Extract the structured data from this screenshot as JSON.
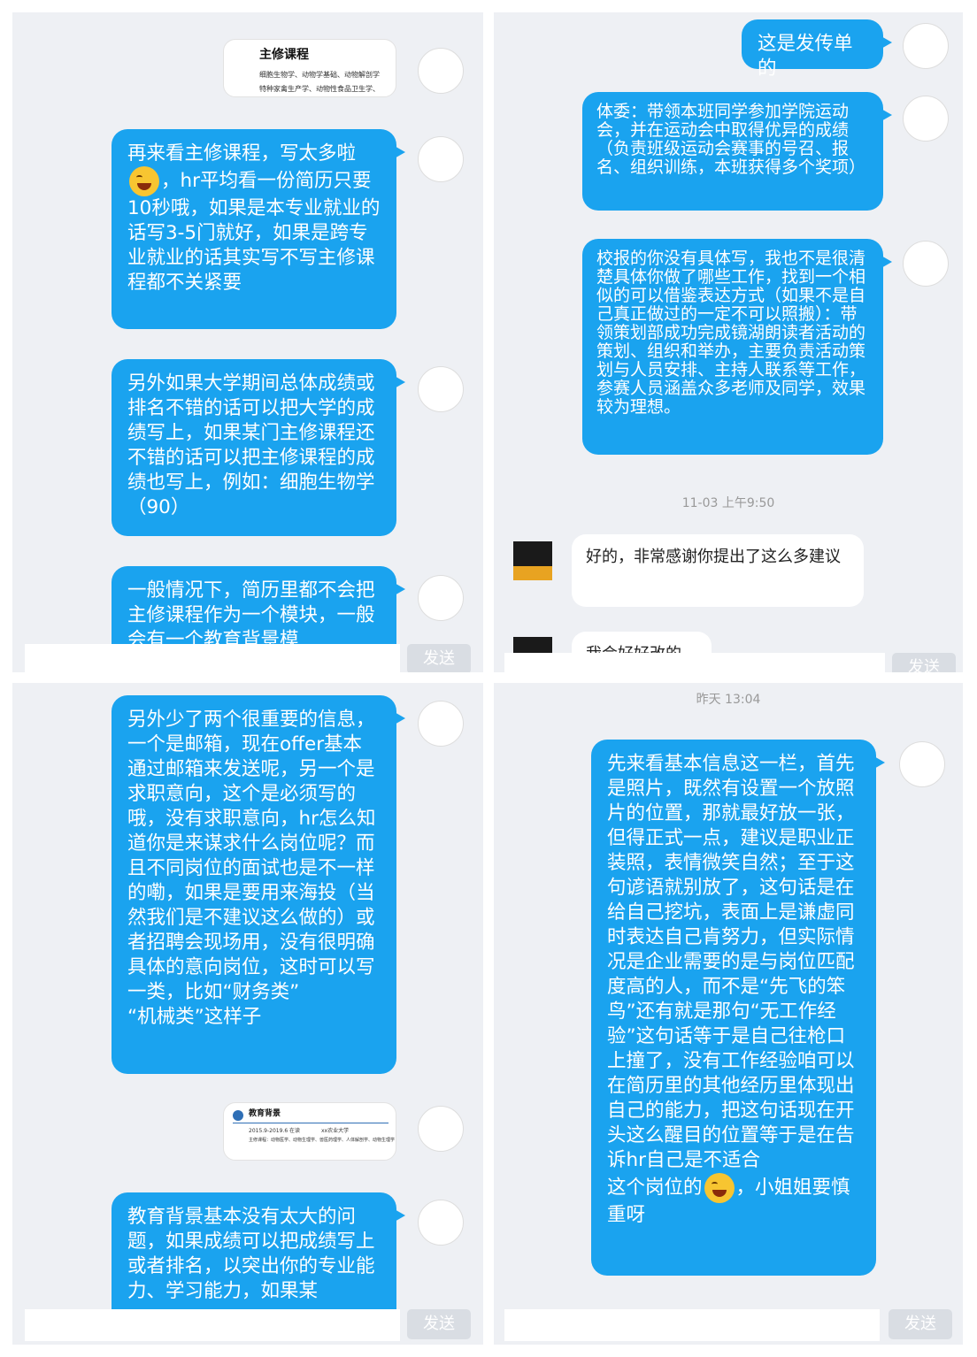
{
  "send_label": "发送",
  "panel_tl": {
    "doc_card": {
      "title": "主修课程",
      "line1": "细胞生物学、动物学基础、动物解剖学",
      "line2": "特种家禽生产学、动物性食品卫生学、"
    },
    "msg1_before": "再来看主修课程，写太多啦",
    "msg1_after": "，hr平均看一份简历只要10秒哦，如果是本专业就业的话写3-5门就好，如果是跨专业就业的话其实写不写主修课程都不关紧要",
    "msg2": "另外如果大学期间总体成绩或排名不错的话可以把大学的成绩写上，如果某门主修课程还不错的话可以把主修课程的成绩也写上，例如：细胞生物学（90）",
    "msg3": "一般情况下，简历里都不会把主修课程作为一个模块，一般会有一个教育背景模"
  },
  "panel_tr": {
    "msg1": "这是发传单的",
    "msg2": "体委：带领本班同学参加学院运动会，并在运动会中取得优异的成绩（负责班级运动会赛事的号召、报名、组织训练，本班获得多个奖项）",
    "msg3": "校报的你没有具体写，我也不是很清楚具体你做了哪些工作，找到一个相似的可以借鉴表达方式（如果不是自己真正做过的一定不可以照搬）：带领策划部成功完成镜湖朗读者活动的策划、组织和举办，主要负责活动策划与人员安排、主持人联系等工作，参赛人员涵盖众多老师及同学，效果较为理想。",
    "timestamp": "11-03 上午9:50",
    "reply1": "好的，非常感谢你提出了这么多建议",
    "reply2": "我会好好改的"
  },
  "panel_bl": {
    "msg1": "另外少了两个很重要的信息，一个是邮箱，现在offer基本通过邮箱来发送呢，另一个是求职意向，这个是必须写的哦，没有求职意向，hr怎么知道你是来谋求什么岗位呢？而且不同岗位的面试也是不一样的嘞，如果是要用来海投（当然我们是不建议这么做的）或者招聘会现场用，没有很明确具体的意向岗位，这时可以写一类，比如“财务类”\n“机械类”这样子",
    "doc_card": {
      "title": "教育背景",
      "line1": "2015.9-2019.6 在读",
      "line2": "xx农业大学",
      "line3": "主修课程：动物医学、动物生理学、兽医药理学、人体解剖学、动物生理学"
    },
    "msg2": "教育背景基本没有太大的问题，如果成绩可以把成绩写上或者排名，以突出你的专业能力、学习能力，如果某"
  },
  "panel_br": {
    "timestamp": "昨天 13:04",
    "msg_before": "先来看基本信息这一栏，首先是照片，既然有设置一个放照片的位置，那就最好放一张，但得正式一点，建议是职业正装照，表情微笑自然；至于这句谚语就别放了，这句话是在给自己挖坑，表面上是谦虚同时表达自己肯努力，但实际情况是企业需要的是与岗位匹配度高的人，而不是“先飞的笨鸟”还有就是那句“无工作经验”这句话等于是自己往枪口上撞了，没有工作经验咱可以在简历里的其他经历里体现出自己的能力，把这句话现在开头这么醒目的位置等于是在告诉hr自己是不适合\n这个岗位的",
    "msg_after": "，小姐姐要慎重呀"
  },
  "colors": {
    "bubble": "#1aa3ef",
    "panel_bg": "#eef0f4"
  }
}
